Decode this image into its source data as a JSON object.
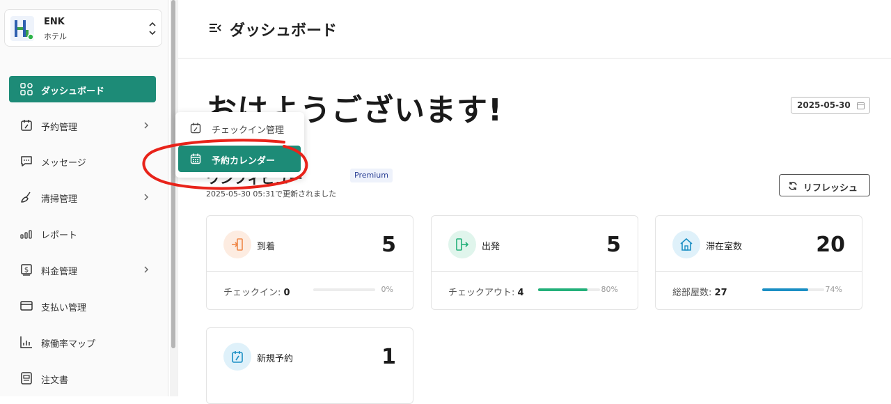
{
  "org": {
    "name": "ENK",
    "type": "ホテル"
  },
  "sidebar": {
    "items": [
      {
        "label": "ダッシュボード",
        "icon": "grid-icon",
        "active": true
      },
      {
        "label": "予約管理",
        "icon": "calendar-icon",
        "has_submenu": true
      },
      {
        "label": "メッセージ",
        "icon": "message-icon"
      },
      {
        "label": "清掃管理",
        "icon": "broom-icon",
        "has_submenu": true
      },
      {
        "label": "レポート",
        "icon": "bar-chart-icon"
      },
      {
        "label": "料金管理",
        "icon": "dollar-icon",
        "has_submenu": true
      },
      {
        "label": "支払い管理",
        "icon": "credit-card-icon"
      },
      {
        "label": "稼働率マップ",
        "icon": "chart-icon"
      },
      {
        "label": "注文書",
        "icon": "document-icon"
      }
    ]
  },
  "header": {
    "title": "ダッシュボード"
  },
  "main": {
    "greeting": "おはようございます!",
    "date": "2025-05-30",
    "section_title": "ワンフィビュー",
    "badge": "Premium",
    "updated_text": "2025-05-30 05:31で更新されました",
    "refresh_label": "リフレッシュ",
    "cards": [
      {
        "label": "到着",
        "value": "5",
        "sub_label": "チェックイン:",
        "sub_value": "0",
        "percent_text": "0%",
        "percent": 0,
        "color": "#f0894a",
        "bg": "#fdece1"
      },
      {
        "label": "出発",
        "value": "5",
        "sub_label": "チェックアウト:",
        "sub_value": "4",
        "percent_text": "80%",
        "percent": 80,
        "color": "#23b07a",
        "bg": "#e0f5ec"
      },
      {
        "label": "滞在室数",
        "value": "20",
        "sub_label": "総部屋数:",
        "sub_value": "27",
        "percent_text": "74%",
        "percent": 74,
        "color": "#1b8fc4",
        "bg": "#dff1fa"
      },
      {
        "label": "新規予約",
        "value": "1",
        "color": "#1b8fc4",
        "bg": "#dff1fa"
      }
    ]
  },
  "dropdown": {
    "items": [
      {
        "label": "チェックイン管理",
        "active": false
      },
      {
        "label": "予約カレンダー",
        "active": true
      }
    ]
  },
  "colors": {
    "accent": "#1d8b77",
    "annotation": "#e8231a"
  }
}
